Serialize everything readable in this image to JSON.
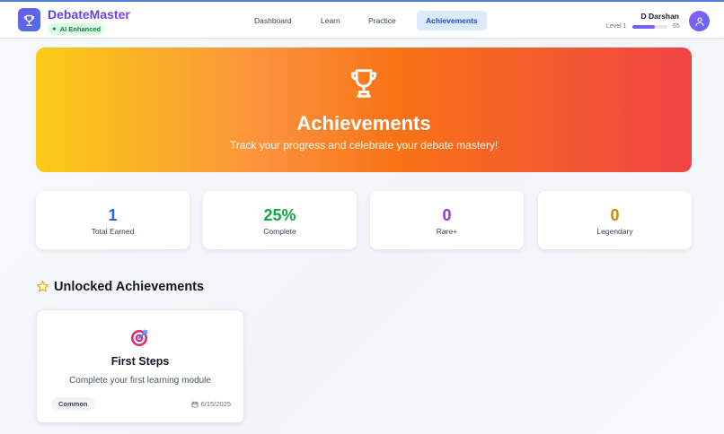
{
  "header": {
    "brand": "DebateMaster",
    "ai_badge": "AI Enhanced",
    "nav": [
      {
        "label": "Dashboard",
        "active": false
      },
      {
        "label": "Learn",
        "active": false
      },
      {
        "label": "Practice",
        "active": false
      },
      {
        "label": "Achievements",
        "active": true
      }
    ],
    "user": {
      "name": "D Darshan",
      "level_label": "Level 1",
      "xp_value": "65",
      "xp_progress_percent": 65
    }
  },
  "hero": {
    "icon": "trophy-icon",
    "title": "Achievements",
    "subtitle": "Track your progress and celebrate your debate mastery!"
  },
  "stats": [
    {
      "value": "1",
      "label": "Total Earned",
      "color": "#2563eb"
    },
    {
      "value": "25%",
      "label": "Complete",
      "color": "#16a34a"
    },
    {
      "value": "0",
      "label": "Rare+",
      "color": "#9333ea"
    },
    {
      "value": "0",
      "label": "Legendary",
      "color": "#ca8a04"
    }
  ],
  "unlocked": {
    "title": "Unlocked Achievements",
    "icon": "star-icon",
    "items": [
      {
        "icon": "target-icon",
        "title": "First Steps",
        "description": "Complete your first learning module",
        "rarity": "Common",
        "date": "6/15/2025"
      }
    ]
  },
  "colors": {
    "accent": "#4f46e5",
    "hero_gradient": [
      "#facc15",
      "#f97316",
      "#ef4444"
    ],
    "active_nav_bg": "#dbeafe"
  }
}
